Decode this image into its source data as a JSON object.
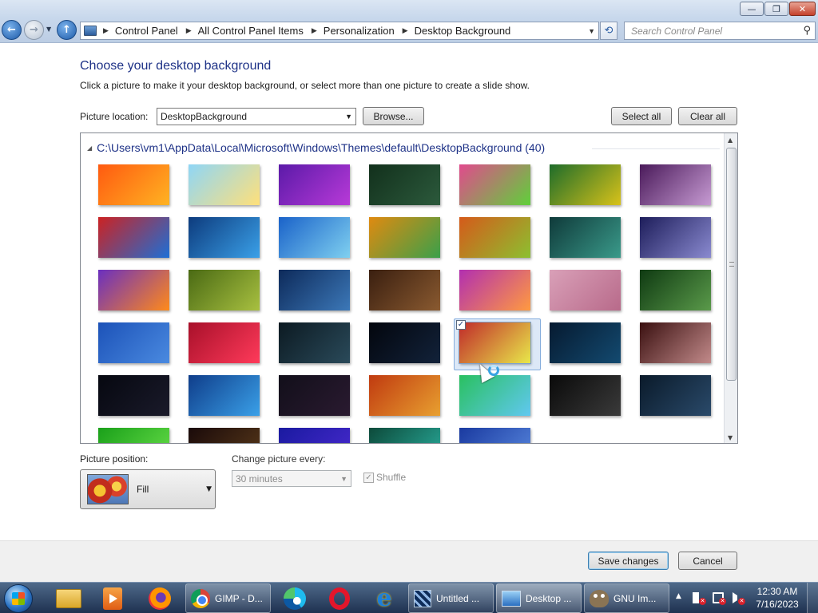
{
  "window": {
    "minimize_glyph": "—",
    "maximize_glyph": "❐",
    "close_glyph": "✕"
  },
  "nav": {
    "back_glyph": "←",
    "forward_glyph": "→",
    "up_glyph": "↑",
    "breadcrumbs": [
      "Control Panel",
      "All Control Panel Items",
      "Personalization",
      "Desktop Background"
    ],
    "search_placeholder": "Search Control Panel"
  },
  "content": {
    "heading": "Choose your desktop background",
    "subtitle": "Click a picture to make it your desktop background, or select more than one picture to create a slide show.",
    "picture_location_label": "Picture location:",
    "picture_location_value": "DesktopBackground",
    "browse_label": "Browse...",
    "select_all_label": "Select all",
    "clear_all_label": "Clear all",
    "folder_path": "C:\\Users\\vm1\\AppData\\Local\\Microsoft\\Windows\\Themes\\default\\DesktopBackground (40)",
    "selected_index": 25,
    "thumbnails": [
      {
        "colors": [
          "#ff5a10",
          "#ffb322"
        ]
      },
      {
        "colors": [
          "#8fd6f6",
          "#ffe07a"
        ]
      },
      {
        "colors": [
          "#5b1aa8",
          "#b83ad8"
        ]
      },
      {
        "colors": [
          "#12301c",
          "#2c5a3c"
        ]
      },
      {
        "colors": [
          "#e14a8d",
          "#5fd03a"
        ]
      },
      {
        "colors": [
          "#1e6c2a",
          "#d8c21a"
        ]
      },
      {
        "colors": [
          "#4a1a5a",
          "#c79bd3"
        ]
      },
      {
        "colors": [
          "#c22",
          "#1d6fd6"
        ]
      },
      {
        "colors": [
          "#0d3b7d",
          "#3aa0e8"
        ]
      },
      {
        "colors": [
          "#1a62c9",
          "#7fd0f0"
        ]
      },
      {
        "colors": [
          "#e08a10",
          "#3aa04a"
        ]
      },
      {
        "colors": [
          "#d55a1a",
          "#8cc030"
        ]
      },
      {
        "colors": [
          "#0f3a3a",
          "#3a9a8a"
        ]
      },
      {
        "colors": [
          "#1d1d5a",
          "#8a8ad0"
        ]
      },
      {
        "colors": [
          "#6a2fc0",
          "#ff8a1a"
        ]
      },
      {
        "colors": [
          "#4a6a14",
          "#a8c040"
        ]
      },
      {
        "colors": [
          "#0d2a5a",
          "#3c78b8"
        ]
      },
      {
        "colors": [
          "#3a1f10",
          "#8a5a30"
        ]
      },
      {
        "colors": [
          "#b22fb0",
          "#ff9a40"
        ]
      },
      {
        "colors": [
          "#d9a0b8",
          "#b86a8a"
        ]
      },
      {
        "colors": [
          "#0f3a12",
          "#5a9a4a"
        ]
      },
      {
        "colors": [
          "#1c52b8",
          "#4a8ae0"
        ]
      },
      {
        "colors": [
          "#a8102a",
          "#ff3a5a"
        ]
      },
      {
        "colors": [
          "#0c1a22",
          "#2a4a5a"
        ]
      },
      {
        "colors": [
          "#03060d",
          "#12223a"
        ]
      },
      {
        "colors": [
          "#c02a2a",
          "#e8e84a"
        ]
      },
      {
        "colors": [
          "#061a30",
          "#134a70"
        ]
      },
      {
        "colors": [
          "#3a1010",
          "#c28a8a"
        ]
      },
      {
        "colors": [
          "#060810",
          "#1a1a2a"
        ]
      },
      {
        "colors": [
          "#0f3d8a",
          "#3aa0e8"
        ]
      },
      {
        "colors": [
          "#120f1a",
          "#2a1a30"
        ]
      },
      {
        "colors": [
          "#c03a10",
          "#e8a030"
        ]
      },
      {
        "colors": [
          "#2ac060",
          "#60c8f0"
        ]
      },
      {
        "colors": [
          "#0a0a0a",
          "#3a3a3a"
        ]
      },
      {
        "colors": [
          "#0a1a2a",
          "#2a4a6a"
        ]
      },
      {
        "colors": [
          "#1aa01a",
          "#6ae04a"
        ]
      },
      {
        "colors": [
          "#1a0a0a",
          "#5a3a1a"
        ]
      },
      {
        "colors": [
          "#1a1aa0",
          "#4a2ad0"
        ]
      },
      {
        "colors": [
          "#0d4a3a",
          "#2ab0a0"
        ]
      },
      {
        "colors": [
          "#1a3aa0",
          "#5a8ae0"
        ]
      }
    ],
    "picture_position_label": "Picture position:",
    "picture_position_value": "Fill",
    "change_every_label": "Change picture every:",
    "change_every_value": "30 minutes",
    "shuffle_label": "Shuffle",
    "shuffle_checked": true,
    "save_label": "Save changes",
    "cancel_label": "Cancel"
  },
  "taskbar": {
    "items": [
      {
        "label": "GIMP - D..."
      },
      {
        "label": "Untitled ..."
      },
      {
        "label": "Desktop ..."
      },
      {
        "label": "GNU Im..."
      }
    ],
    "tray_chevron": "▲",
    "clock_time": "12:30 AM",
    "clock_date": "7/16/2023"
  }
}
